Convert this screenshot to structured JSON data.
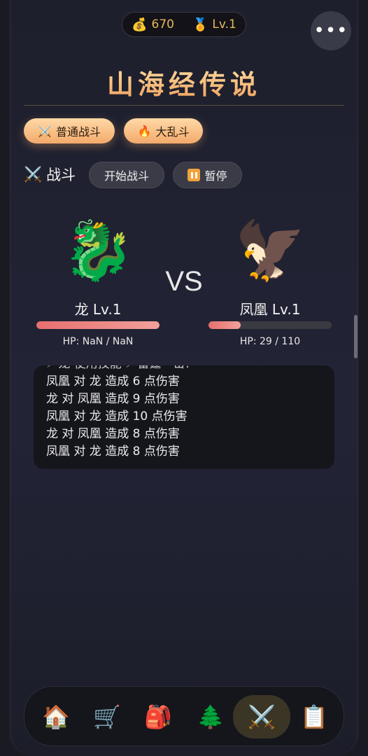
{
  "header": {
    "gold": "670",
    "level": "Lv.1",
    "gold_icon": "💰",
    "level_icon": "🏅",
    "more_label": "•••"
  },
  "title": "山海经传说",
  "modes": [
    {
      "icon": "⚔️",
      "label": "普通战斗"
    },
    {
      "icon": "🔥",
      "label": "大乱斗"
    }
  ],
  "battle": {
    "icon": "⚔️",
    "label": "战斗",
    "start_label": "开始战斗",
    "pause_label": "暂停"
  },
  "fighters": {
    "left": {
      "emoji": "🐉",
      "name": "龙 Lv.1",
      "hp_text": "HP: NaN / NaN",
      "hp_fraction": 1.0
    },
    "vs": "VS",
    "right": {
      "emoji": "🦅",
      "name": "凤凰 Lv.1",
      "hp_text": "HP: 29 / 110",
      "hp_fraction": 0.264
    }
  },
  "log": {
    "partial": "⚡ 龙 使用技能 ⚡ 雷霆一击!",
    "lines": [
      "凤凰 对 龙 造成 6 点伤害",
      "龙 对 凤凰 造成 9 点伤害",
      "凤凰 对 龙 造成 10 点伤害",
      "龙 对 凤凰 造成 8 点伤害",
      "凤凰 对 龙 造成 8 点伤害"
    ]
  },
  "nav": [
    {
      "icon": "🏠",
      "name": "home"
    },
    {
      "icon": "🛒",
      "name": "shop"
    },
    {
      "icon": "🎒",
      "name": "bag"
    },
    {
      "icon": "🌲",
      "name": "explore"
    },
    {
      "icon": "⚔️",
      "name": "battle",
      "active": true
    },
    {
      "icon": "📋",
      "name": "tasks"
    }
  ]
}
